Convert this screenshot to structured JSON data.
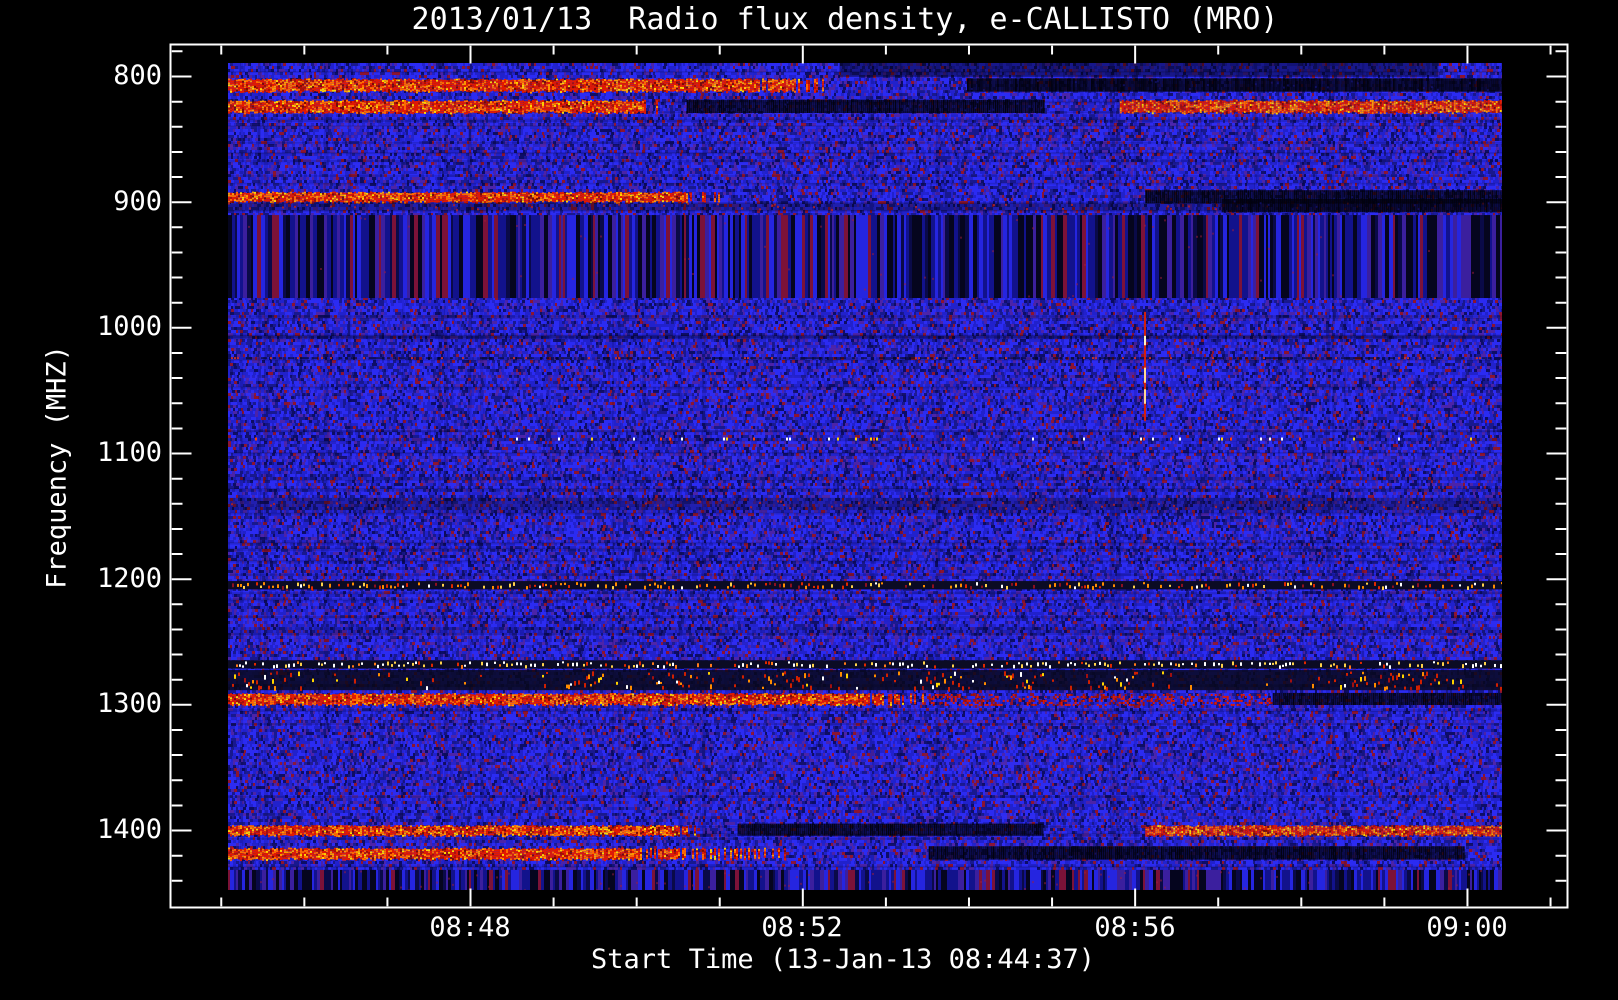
{
  "page": {
    "background": "#000000",
    "text_color": "#ffffff"
  },
  "chart_data": {
    "type": "heatmap",
    "subtype": "radio-spectrogram",
    "title": "2013/01/13  Radio flux density, e-CALLISTO (MRO)",
    "xlabel": "Start Time (13-Jan-13 08:44:37)",
    "ylabel": "Frequency (MHZ)",
    "x_tick_labels": [
      "08:48",
      "08:52",
      "08:56",
      "09:00"
    ],
    "x_minor_tick_interval": "1 minute",
    "y_tick_values": [
      800,
      900,
      1000,
      1100,
      1200,
      1300,
      1400
    ],
    "y_minor_step_mhz": 20,
    "y_axis_inverted": true,
    "freq_range_mhz": [
      790,
      1448
    ],
    "grid": false,
    "legend": "none",
    "colors": {
      "background": "#000000",
      "axis": "#ffffff",
      "noise_blue_bright": "#2b2bf2",
      "noise_blue_mid": "#2121cc",
      "noise_blue_dark": "#18188f",
      "noise_purple": "#4b23a8",
      "noise_deep": "#0d0d66",
      "noise_red_speck": "#8c1430",
      "band_red": "#e31a00",
      "band_orange": "#ff6a00",
      "band_yellow": "#ffd400",
      "band_white": "#ffffff",
      "band_black": "#020210"
    },
    "features": [
      {
        "type": "dark_band",
        "desc": "dark drift streaks near top edge",
        "freq_mhz": [
          790,
          801
        ],
        "time_frac": [
          0.48,
          0.95
        ],
        "strength": 0.45
      },
      {
        "type": "red_band",
        "desc": "strong RFI band ~808 MHz, first half",
        "freq_mhz": [
          803,
          812
        ],
        "time_frac": [
          0.0,
          0.47
        ],
        "fade_tail": 0.12
      },
      {
        "type": "black_band",
        "desc": "absorption/black band ~808 MHz, right part",
        "freq_mhz": [
          803,
          812
        ],
        "time_frac": [
          0.58,
          1.0
        ]
      },
      {
        "type": "red_band",
        "desc": "strong RFI band ~825 MHz, left",
        "freq_mhz": [
          820,
          829
        ],
        "time_frac": [
          0.0,
          0.34
        ],
        "fade_tail": 0.05
      },
      {
        "type": "black_band",
        "desc": "black gap ~825 MHz, middle",
        "freq_mhz": [
          820,
          829
        ],
        "time_frac": [
          0.36,
          0.64
        ]
      },
      {
        "type": "red_band",
        "desc": "strong RFI band ~825 MHz, right",
        "freq_mhz": [
          820,
          829
        ],
        "time_frac": [
          0.7,
          1.0
        ]
      },
      {
        "type": "red_band",
        "desc": "RFI line ~895 MHz, left",
        "freq_mhz": [
          893,
          900
        ],
        "time_frac": [
          0.0,
          0.39
        ],
        "fade_tail": 0.1
      },
      {
        "type": "black_band",
        "desc": "black band ~895 MHz, right",
        "freq_mhz": [
          892,
          901
        ],
        "time_frac": [
          0.72,
          1.0
        ]
      },
      {
        "type": "dark_band",
        "desc": "dark row ~904 MHz",
        "freq_mhz": [
          901,
          908
        ],
        "time_frac": [
          0.0,
          1.0
        ],
        "strength": 0.3,
        "redspeck": true
      },
      {
        "type": "black_band",
        "desc": "black row ~904 MHz, right",
        "freq_mhz": [
          899,
          908
        ],
        "time_frac": [
          0.78,
          1.0
        ]
      },
      {
        "type": "striped_region",
        "desc": "vertically striped broadcast band 910-977 MHz",
        "freq_mhz": [
          911,
          977
        ],
        "time_frac": [
          0.0,
          1.0
        ]
      },
      {
        "type": "faint_red_line",
        "desc": "faint interference line ~1025 MHz",
        "freq_mhz": [
          1024,
          1028
        ],
        "time_frac": [
          0.0,
          1.0
        ]
      },
      {
        "type": "vline",
        "desc": "bright vertical burst streak ~08:56",
        "freq_mhz": [
          988,
          1075
        ],
        "time_frac": [
          0.719
        ]
      },
      {
        "type": "speck_row",
        "desc": "sparse bright specks ~1090 MHz",
        "freq_mhz": [
          1088,
          1092
        ],
        "time_frac": [
          0.0,
          1.0
        ]
      },
      {
        "type": "dark_band",
        "desc": "darker band with red speckle ~1140 MHz",
        "freq_mhz": [
          1136,
          1146
        ],
        "time_frac": [
          0.0,
          1.0
        ],
        "strength": 0.28,
        "redspeck": true
      },
      {
        "type": "dotted_row",
        "desc": "periodic orange/red pulsed line ~1205 MHz",
        "freq_mhz": [
          1203,
          1208
        ],
        "time_frac": [
          0.0,
          1.0
        ],
        "palette": "orange"
      },
      {
        "type": "dotted_row",
        "desc": "dense white dashed line ~1268 MHz",
        "freq_mhz": [
          1266,
          1271
        ],
        "time_frac": [
          0.0,
          1.0
        ],
        "palette": "white"
      },
      {
        "type": "burst_band",
        "desc": "dark band with orange/yellow bursts 1273-1289 MHz",
        "freq_mhz": [
          1273,
          1289
        ],
        "time_frac": [
          0.0,
          1.0
        ],
        "clusters": [
          0.02,
          0.28,
          0.35,
          0.44,
          0.56,
          0.63,
          0.69,
          0.89,
          0.93
        ]
      },
      {
        "type": "red_band",
        "desc": "red RFI band ~1296 MHz, left",
        "freq_mhz": [
          1292,
          1300
        ],
        "time_frac": [
          0.0,
          0.55
        ],
        "fade_tail": 0.1
      },
      {
        "type": "red_speckle_band",
        "desc": "speckled red ~1296 MHz, middle-right",
        "freq_mhz": [
          1292,
          1300
        ],
        "time_frac": [
          0.55,
          0.82
        ]
      },
      {
        "type": "black_band",
        "desc": "black ~1296 MHz, far right",
        "freq_mhz": [
          1292,
          1300
        ],
        "time_frac": [
          0.82,
          1.0
        ]
      },
      {
        "type": "red_band",
        "desc": "red RFI band ~1400 MHz, left",
        "freq_mhz": [
          1397,
          1404
        ],
        "time_frac": [
          0.0,
          0.38
        ],
        "fade_tail": 0.08
      },
      {
        "type": "black_band",
        "desc": "black band ~1400 MHz, middle",
        "freq_mhz": [
          1396,
          1404
        ],
        "time_frac": [
          0.4,
          0.64
        ]
      },
      {
        "type": "red_band",
        "desc": "red RFI band ~1400 MHz, right",
        "freq_mhz": [
          1397,
          1404
        ],
        "time_frac": [
          0.72,
          1.0
        ]
      },
      {
        "type": "red_band",
        "desc": "red RFI band ~1418 MHz, left",
        "freq_mhz": [
          1415,
          1423
        ],
        "time_frac": [
          0.0,
          0.45
        ],
        "fade_tail": 0.35
      },
      {
        "type": "black_band",
        "desc": "dark band ~1418 MHz, right",
        "freq_mhz": [
          1414,
          1423
        ],
        "time_frac": [
          0.55,
          0.97
        ]
      },
      {
        "type": "striped_region",
        "desc": "vertically striped band at bottom edge",
        "freq_mhz": [
          1432,
          1448
        ],
        "time_frac": [
          0.0,
          1.0
        ]
      }
    ]
  }
}
